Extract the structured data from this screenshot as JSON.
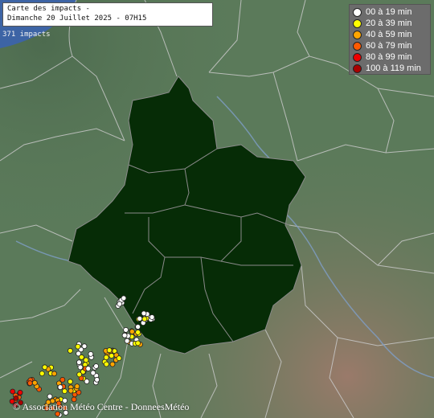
{
  "title": {
    "line1": "Carte des impacts -",
    "line2": "Dimanche 20 Juillet 2025 - 07H15"
  },
  "impact_count": "371 impacts",
  "legend": {
    "items": [
      {
        "label": "00 à 19 min",
        "color": "#ffffff"
      },
      {
        "label": "20 à 39 min",
        "color": "#ffff00"
      },
      {
        "label": "40 à 59 min",
        "color": "#ffa500"
      },
      {
        "label": "60 à 79 min",
        "color": "#ff5a00"
      },
      {
        "label": "80 à 99 min",
        "color": "#ee0000"
      },
      {
        "label": "100 à 119 min",
        "color": "#aa0000"
      }
    ]
  },
  "credit": "© Association Météo Centre - DonneesMétéo",
  "colors": {
    "region_fill": "#062c06",
    "land": "#5b7a5a",
    "border": "#c9c9c9",
    "river": "#7f9fc8",
    "sea": "#3d64a5"
  }
}
